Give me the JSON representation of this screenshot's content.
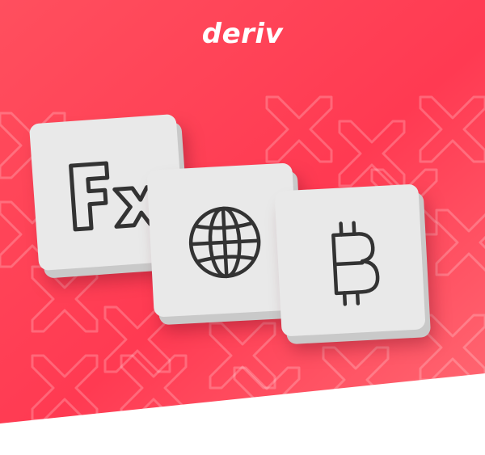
{
  "brand": {
    "logo_text": "deriv",
    "colors": {
      "primary_red": "#ff444f",
      "dark_red": "#f0294a",
      "tile_gray": "#e9e9e9",
      "icon_stroke": "#333333",
      "white": "#ffffff"
    }
  },
  "tiles": [
    {
      "icon": "fx-icon",
      "label": "Fx"
    },
    {
      "icon": "globe-icon"
    },
    {
      "icon": "bitcoin-icon"
    }
  ]
}
